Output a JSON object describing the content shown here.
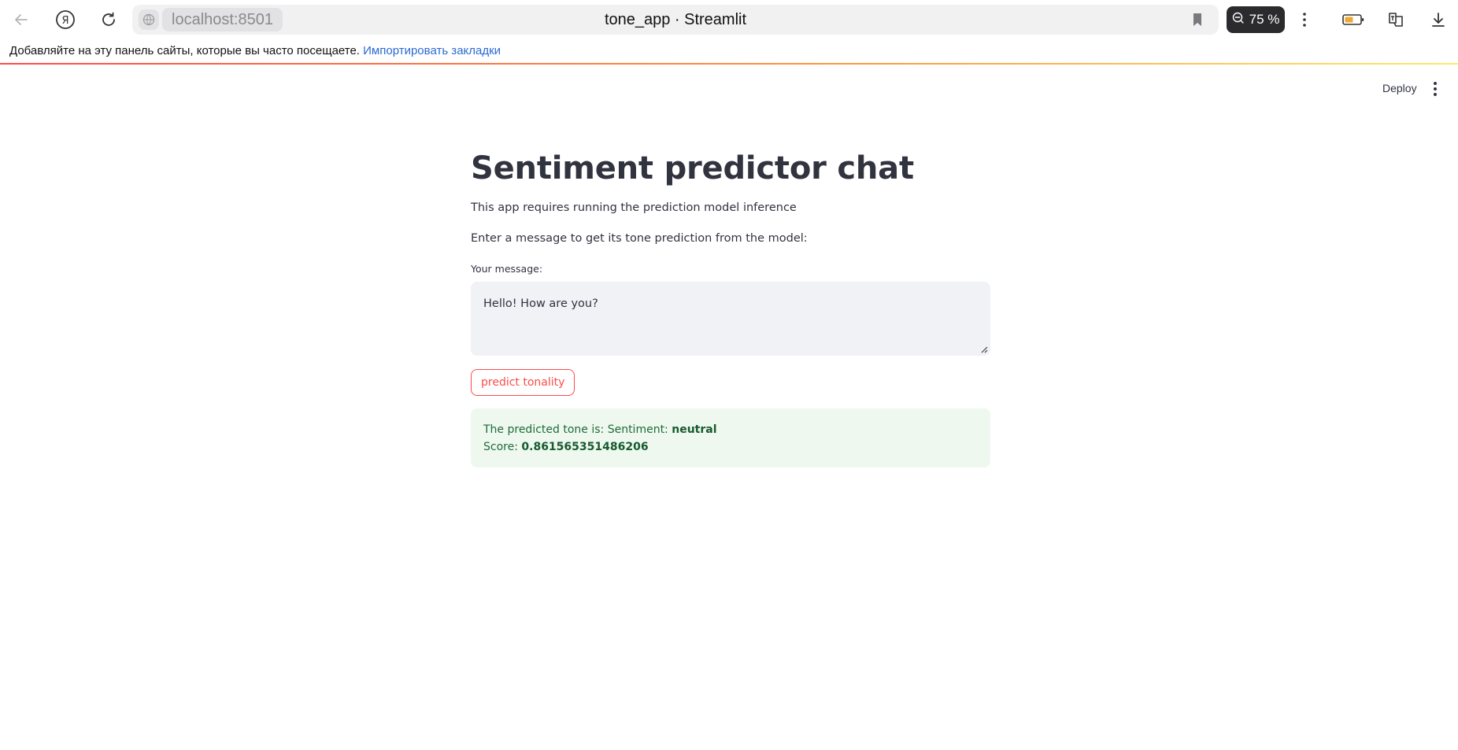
{
  "browser": {
    "url": "localhost:8501",
    "tab_title": "tone_app · Streamlit",
    "zoom": "75 %",
    "bookmarks_bar_text": "Добавляйте на эту панель сайты, которые вы часто посещаете.",
    "bookmarks_bar_link": "Импортировать закладки",
    "icons": [
      "back-arrow-icon",
      "yandex-icon",
      "reload-icon",
      "site-info-icon",
      "bookmark-icon",
      "zoom-icon",
      "more-icon",
      "battery-icon",
      "translate-icon",
      "download-icon"
    ]
  },
  "header": {
    "deploy_label": "Deploy"
  },
  "main": {
    "title": "Sentiment predictor chat",
    "description": "This app requires running the prediction model inference",
    "instruction": "Enter a message to get its tone prediction from the model:",
    "input_label": "Your message:",
    "input_value": "Hello! How are you?",
    "button_label": "predict tonality",
    "result": {
      "line1_prefix": "The predicted tone is: Sentiment: ",
      "sentiment": "neutral",
      "line2_prefix": "Score: ",
      "score": "0.861565351486206"
    }
  },
  "colors": {
    "accent": "#ff4b4b",
    "success_bg": "#eef8ef",
    "success_text": "#1f6b3a",
    "input_bg": "#f0f2f6"
  }
}
